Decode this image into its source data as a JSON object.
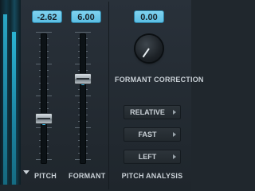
{
  "pitch": {
    "value": "-2.62",
    "label": "PITCH",
    "level": 0.35
  },
  "formant": {
    "value": "6.00",
    "label": "FORMANT",
    "level": 0.65
  },
  "formant_correction": {
    "value": "0.00",
    "label": "FORMANT CORRECTION"
  },
  "pitch_analysis": {
    "label": "PITCH ANALYSIS",
    "options": [
      "RELATIVE",
      "FAST",
      "LEFT"
    ]
  },
  "colors": {
    "accent": "#5cbfe4",
    "fill": "#1ea8da",
    "background": "#20272d"
  },
  "icons": {
    "meter_menu": "triangle-down-icon",
    "dropdown": "triangle-right-icon"
  }
}
